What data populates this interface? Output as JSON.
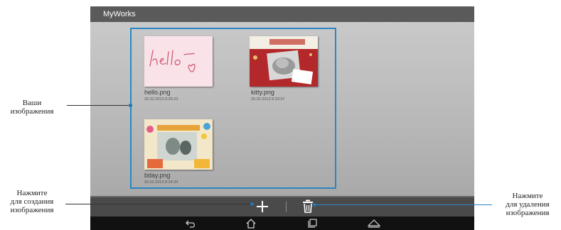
{
  "app": {
    "title": "MyWorks"
  },
  "gallery": {
    "items": [
      {
        "name": "hello.png",
        "date": "26.02.2013 8:35:23"
      },
      {
        "name": "kitty.png",
        "date": "26.02.2013 8:33:37"
      },
      {
        "name": "bday.png",
        "date": "26.02.2013 8:34:34"
      }
    ]
  },
  "toolbar": {
    "add_icon": "plus-icon",
    "delete_icon": "trash-icon"
  },
  "navbar": {
    "icons": [
      "back-icon",
      "home-icon",
      "recent-apps-icon",
      "menu-up-icon"
    ]
  },
  "callouts": {
    "images_line1": "Ваши",
    "images_line2": "изображения",
    "create_line1": "Нажмите",
    "create_line2": "для создания",
    "create_line3": "изображения",
    "delete_line1": "Нажмите",
    "delete_line2": "для удаления",
    "delete_line3": "изображения"
  },
  "colors": {
    "accent": "#2b86c5",
    "titlebar": "#5a5a5a",
    "navbar": "#111111"
  }
}
